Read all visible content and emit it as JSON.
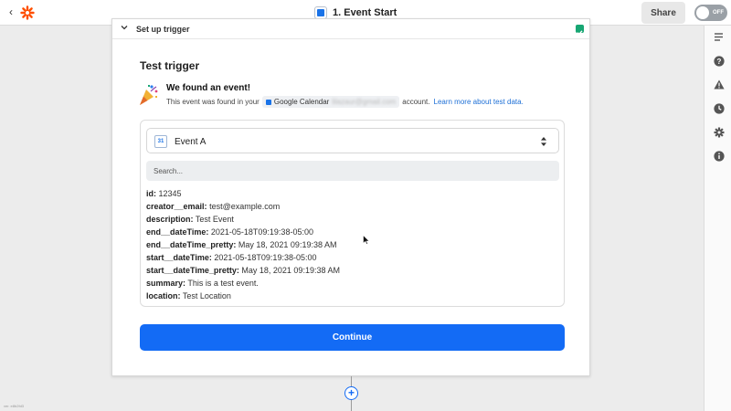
{
  "topbar": {
    "back_glyph": "‹",
    "title": "1. Event Start",
    "share_label": "Share",
    "toggle_label": "OFF"
  },
  "card": {
    "header_title": "Set up trigger",
    "section_title": "Test trigger",
    "found_title": "We found an event!",
    "found_prefix": "This event was found in your",
    "account_app": "Google Calendar",
    "account_email": "lilazaur@gmail.com",
    "found_suffix": "account.",
    "learn_more": "Learn more about test data.",
    "event_name": "Event A",
    "event_icon_text": "31",
    "search_placeholder": "Search...",
    "fields": [
      {
        "key": "id:",
        "value": "12345"
      },
      {
        "key": "creator__email:",
        "value": "test@example.com"
      },
      {
        "key": "description:",
        "value": "Test Event"
      },
      {
        "key": "end__dateTime:",
        "value": "2021-05-18T09:19:38-05:00"
      },
      {
        "key": "end__dateTime_pretty:",
        "value": "May 18, 2021 09:19:38 AM"
      },
      {
        "key": "start__dateTime:",
        "value": "2021-05-18T09:19:38-05:00"
      },
      {
        "key": "start__dateTime_pretty:",
        "value": "May 18, 2021 09:19:38 AM"
      },
      {
        "key": "summary:",
        "value": "This is a test event."
      },
      {
        "key": "location:",
        "value": "Test Location"
      }
    ],
    "continue_label": "Continue"
  },
  "sidebar": {
    "icons": [
      "list-icon",
      "help-icon",
      "alert-icon",
      "clock-icon",
      "gear-icon",
      "info-icon"
    ]
  },
  "footer": {
    "version": "ver. e8b2fd3"
  },
  "colors": {
    "accent": "#136bf5",
    "success": "#17a673",
    "brand": "#ff4f00"
  }
}
